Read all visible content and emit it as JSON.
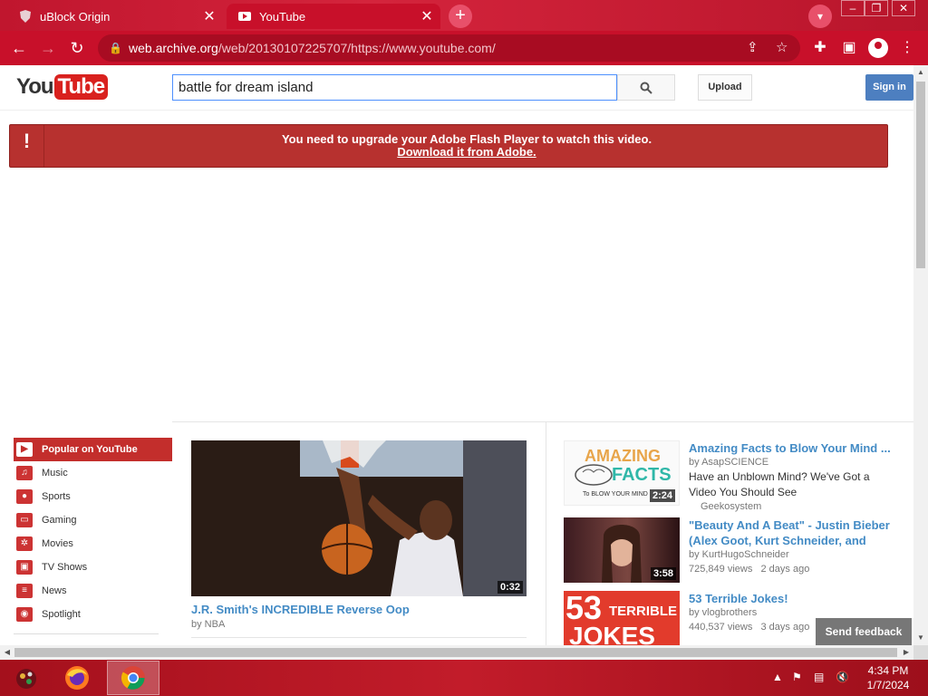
{
  "browser": {
    "tabs": [
      {
        "title": "uBlock Origin",
        "active": false
      },
      {
        "title": "YouTube",
        "active": true
      }
    ],
    "new_tab": "+",
    "url_host": "web.archive.org",
    "url_path": "/web/20130107225707/https://www.youtube.com/"
  },
  "youtube": {
    "logo_you": "You",
    "logo_tube": "Tube",
    "search_value": "battle for dream island",
    "upload_label": "Upload",
    "signin_label": "Sign in",
    "flash_message": "You need to upgrade your Adobe Flash Player to watch this video.",
    "flash_link": "Download it from Adobe.",
    "flash_alert": "!",
    "guide": [
      {
        "label": "Popular on YouTube",
        "icon": "popular-icon",
        "selected": true
      },
      {
        "label": "Music",
        "icon": "headphones-icon",
        "selected": false
      },
      {
        "label": "Sports",
        "icon": "sports-ball-icon",
        "selected": false
      },
      {
        "label": "Gaming",
        "icon": "gamepad-icon",
        "selected": false
      },
      {
        "label": "Movies",
        "icon": "film-reel-icon",
        "selected": false
      },
      {
        "label": "TV Shows",
        "icon": "tv-icon",
        "selected": false
      },
      {
        "label": "News",
        "icon": "newspaper-icon",
        "selected": false
      },
      {
        "label": "Spotlight",
        "icon": "spotlight-icon",
        "selected": false
      }
    ],
    "main_video": {
      "title": "J.R. Smith's INCREDIBLE Reverse Oop",
      "by": "by NBA",
      "duration": "0:32"
    },
    "side_videos": [
      {
        "title": "Amazing Facts to Blow Your Mind ...",
        "by": "by AsapSCIENCE",
        "duration": "2:24",
        "thumb_text_top": "AMAZING",
        "thumb_text_mid": "FACTS",
        "thumb_text_bot": "To BLOW YOUR MIND"
      },
      {
        "title": "Have an Unblown Mind? We've Got a Video You Should See",
        "by": "Geekosystem"
      },
      {
        "title": "\"Beauty And A Beat\" - Justin Bieber (Alex Goot, Kurt Schneider, and",
        "by": "by KurtHugoSchneider",
        "views": "725,849 views",
        "age": "2 days ago",
        "duration": "3:58"
      },
      {
        "title": "53 Terrible Jokes!",
        "by": "by vlogbrothers",
        "views": "440,537 views",
        "age": "3 days ago",
        "thumb_text_top": "53",
        "thumb_text_mid": "TERRIBLE",
        "thumb_text_bot": "JOKES"
      }
    ],
    "send_feedback": "Send feedback"
  },
  "taskbar": {
    "time": "4:34 PM",
    "date": "1/7/2024"
  },
  "colors": {
    "chrome_red": "#c8102a",
    "youtube_link": "#438bc5",
    "flash_bar": "#b7312f"
  }
}
